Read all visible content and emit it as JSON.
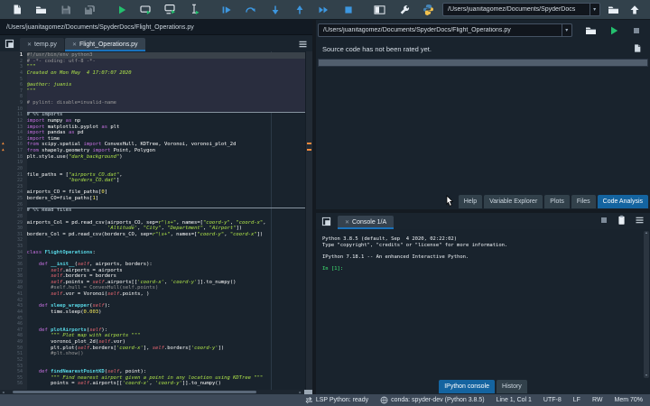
{
  "colors": {
    "accent": "#1464A0",
    "selection": "#1A72BB",
    "run_green": "#24c06e",
    "debug_blue": "#3d97e0",
    "warning": "#f08a3c",
    "background": "#19232D",
    "toolbar": "#32414B",
    "statusbar": "#3d4958",
    "keyword": "#c670e0",
    "string": "#b0e549",
    "comment": "#999999",
    "number": "#faed5c",
    "instance": "#ee6772",
    "definition": "#57d6e4"
  },
  "toolbar": {
    "cwd": "/Users/juanitagomez/Documents/SpyderDocs",
    "items": [
      {
        "name": "new-file",
        "icon": "doc"
      },
      {
        "name": "open-file",
        "icon": "folder"
      },
      {
        "name": "save-file",
        "icon": "save",
        "disabled": true
      },
      {
        "name": "save-all",
        "icon": "save-all",
        "disabled": true
      },
      {
        "sep": true
      },
      {
        "name": "run-file",
        "icon": "play-green"
      },
      {
        "name": "run-cell",
        "icon": "run-cell"
      },
      {
        "name": "run-cell-advance",
        "icon": "run-cell-advance"
      },
      {
        "name": "run-selection",
        "icon": "run-selection"
      },
      {
        "sep": true
      },
      {
        "name": "debug-file",
        "icon": "debug-play"
      },
      {
        "name": "debug-step-over",
        "icon": "debug-step"
      },
      {
        "name": "debug-step-into",
        "icon": "step-into"
      },
      {
        "name": "debug-step-out",
        "icon": "step-out"
      },
      {
        "name": "debug-continue",
        "icon": "continue"
      },
      {
        "name": "debug-stop",
        "icon": "stop-blue"
      },
      {
        "sep": true
      },
      {
        "name": "maximize-pane",
        "icon": "panes"
      },
      {
        "name": "preferences",
        "icon": "wrench"
      },
      {
        "name": "python-path-manager",
        "icon": "python"
      }
    ]
  },
  "editor": {
    "path": "/Users/juanitagomez/Documents/SpyderDocs/Flight_Operations.py",
    "tabs": [
      {
        "label": "temp.py",
        "active": false
      },
      {
        "label": "Flight_Operations.py",
        "active": true
      }
    ],
    "current_line": 1,
    "current_cell_end": 10,
    "lines": [
      {
        "n": 1,
        "t": [
          [
            "c",
            "#!/usr/bin/env python3"
          ]
        ]
      },
      {
        "n": 2,
        "t": [
          [
            "c",
            "# -*- coding: utf-8 -*-"
          ]
        ]
      },
      {
        "n": 3,
        "t": [
          [
            "s",
            "\"\"\""
          ]
        ]
      },
      {
        "n": 4,
        "t": [
          [
            "s",
            "Created on Mon May  4 17:07:07 2020"
          ]
        ]
      },
      {
        "n": 5,
        "t": []
      },
      {
        "n": 6,
        "t": [
          [
            "s",
            "@author: juanis"
          ]
        ]
      },
      {
        "n": 7,
        "t": [
          [
            "s",
            "\"\"\""
          ]
        ]
      },
      {
        "n": 8,
        "t": []
      },
      {
        "n": 9,
        "t": [
          [
            "c",
            "# pylint: disable=invalid-name"
          ]
        ]
      },
      {
        "n": 10,
        "t": []
      },
      {
        "n": 11,
        "sep": true,
        "t": [
          [
            "x",
            "# %% Imports"
          ]
        ]
      },
      {
        "n": 12,
        "t": [
          [
            "k",
            "import"
          ],
          [
            "n",
            " numpy "
          ],
          [
            "k",
            "as"
          ],
          [
            "n",
            " np"
          ]
        ]
      },
      {
        "n": 13,
        "t": [
          [
            "k",
            "import"
          ],
          [
            "n",
            " matplotlib.pyplot "
          ],
          [
            "k",
            "as"
          ],
          [
            "n",
            " plt"
          ]
        ]
      },
      {
        "n": 14,
        "t": [
          [
            "k",
            "import"
          ],
          [
            "n",
            " pandas "
          ],
          [
            "k",
            "as"
          ],
          [
            "n",
            " pd"
          ]
        ]
      },
      {
        "n": 15,
        "t": [
          [
            "k",
            "import"
          ],
          [
            "n",
            " time"
          ]
        ]
      },
      {
        "n": 16,
        "w": true,
        "t": [
          [
            "k",
            "from"
          ],
          [
            "n",
            " scipy.spatial "
          ],
          [
            "k",
            "import"
          ],
          [
            "n",
            " ConvexHull, KDTree, Voronoi, voronoi_plot_2d"
          ]
        ]
      },
      {
        "n": 17,
        "w": true,
        "t": [
          [
            "k",
            "from"
          ],
          [
            "n",
            " shapely.geometry "
          ],
          [
            "k",
            "import"
          ],
          [
            "n",
            " Point, Polygon"
          ]
        ]
      },
      {
        "n": 18,
        "t": [
          [
            "n",
            "plt.style.use("
          ],
          [
            "s",
            "\"dark_background\""
          ],
          [
            "n",
            ")"
          ]
        ]
      },
      {
        "n": 19,
        "t": []
      },
      {
        "n": 20,
        "t": []
      },
      {
        "n": 21,
        "t": [
          [
            "n",
            "file_paths = ["
          ],
          [
            "s",
            "\"airports_CO.dat\""
          ],
          [
            "n",
            ","
          ]
        ]
      },
      {
        "n": 22,
        "t": [
          [
            "n",
            "              "
          ],
          [
            "s",
            "\"borders_CO.dat\""
          ],
          [
            "n",
            "]"
          ]
        ]
      },
      {
        "n": 23,
        "t": []
      },
      {
        "n": 24,
        "t": [
          [
            "n",
            "airports_CO = file_paths["
          ],
          [
            "u",
            "0"
          ],
          [
            "n",
            "]"
          ]
        ]
      },
      {
        "n": 25,
        "t": [
          [
            "n",
            "borders_CO=file_paths["
          ],
          [
            "u",
            "1"
          ],
          [
            "n",
            "]"
          ]
        ]
      },
      {
        "n": 26,
        "t": []
      },
      {
        "n": 27,
        "sep": true,
        "t": [
          [
            "x",
            "# %% Read files"
          ]
        ]
      },
      {
        "n": 28,
        "t": []
      },
      {
        "n": 29,
        "t": [
          [
            "n",
            "airports_Col = pd.read_csv(airports_CO, sep="
          ],
          [
            "s",
            "r\"\\s+\""
          ],
          [
            "n",
            ", names=["
          ],
          [
            "s",
            "\"coord-y\""
          ],
          [
            "n",
            ", "
          ],
          [
            "s",
            "\"coord-x\""
          ],
          [
            "n",
            ","
          ]
        ]
      },
      {
        "n": 30,
        "t": [
          [
            "n",
            "                           "
          ],
          [
            "s",
            "'Altitude'"
          ],
          [
            "n",
            ", "
          ],
          [
            "s",
            "\"City\""
          ],
          [
            "n",
            ", "
          ],
          [
            "s",
            "\"Department\""
          ],
          [
            "n",
            ", "
          ],
          [
            "s",
            "\"Airport\""
          ],
          [
            "n",
            "])"
          ]
        ]
      },
      {
        "n": 31,
        "t": [
          [
            "n",
            "borders_Col = pd.read_csv(borders_CO, sep="
          ],
          [
            "s",
            "r\"\\s+\""
          ],
          [
            "n",
            ", names=["
          ],
          [
            "s",
            "\"coord-y\""
          ],
          [
            "n",
            ", "
          ],
          [
            "s",
            "\"coord-x\""
          ],
          [
            "n",
            "])"
          ]
        ]
      },
      {
        "n": 32,
        "t": []
      },
      {
        "n": 33,
        "t": []
      },
      {
        "n": 34,
        "t": [
          [
            "k",
            "class"
          ],
          [
            "n",
            " "
          ],
          [
            "d",
            "FlightOperations"
          ],
          [
            "n",
            ":"
          ]
        ]
      },
      {
        "n": 35,
        "t": []
      },
      {
        "n": 36,
        "t": [
          [
            "n",
            "    "
          ],
          [
            "k",
            "def"
          ],
          [
            "n",
            " "
          ],
          [
            "d",
            "__init__"
          ],
          [
            "n",
            "("
          ],
          [
            "i",
            "self"
          ],
          [
            "n",
            ", airports, borders):"
          ]
        ]
      },
      {
        "n": 37,
        "t": [
          [
            "n",
            "        "
          ],
          [
            "i",
            "self"
          ],
          [
            "n",
            ".airports = airports"
          ]
        ]
      },
      {
        "n": 38,
        "t": [
          [
            "n",
            "        "
          ],
          [
            "i",
            "self"
          ],
          [
            "n",
            ".borders = borders"
          ]
        ]
      },
      {
        "n": 39,
        "t": [
          [
            "n",
            "        "
          ],
          [
            "i",
            "self"
          ],
          [
            "n",
            ".points = "
          ],
          [
            "i",
            "self"
          ],
          [
            "n",
            ".airports[["
          ],
          [
            "s",
            "'coord-x'"
          ],
          [
            "n",
            ", "
          ],
          [
            "s",
            "'coord-y'"
          ],
          [
            "n",
            "]].to_numpy()"
          ]
        ]
      },
      {
        "n": 40,
        "t": [
          [
            "c",
            "        #self.hull = ConvexHull(self.points)"
          ]
        ]
      },
      {
        "n": 41,
        "t": [
          [
            "n",
            "        "
          ],
          [
            "i",
            "self"
          ],
          [
            "n",
            ".vor = Voronoi("
          ],
          [
            "i",
            "self"
          ],
          [
            "n",
            ".points, )"
          ]
        ]
      },
      {
        "n": 42,
        "t": []
      },
      {
        "n": 43,
        "t": [
          [
            "n",
            "    "
          ],
          [
            "k",
            "def"
          ],
          [
            "n",
            " "
          ],
          [
            "d",
            "sleep_wrapper"
          ],
          [
            "n",
            "("
          ],
          [
            "i",
            "self"
          ],
          [
            "n",
            "):"
          ]
        ]
      },
      {
        "n": 44,
        "t": [
          [
            "n",
            "        time.sleep("
          ],
          [
            "u",
            "0.003"
          ],
          [
            "n",
            ")"
          ]
        ]
      },
      {
        "n": 45,
        "t": []
      },
      {
        "n": 46,
        "t": []
      },
      {
        "n": 47,
        "t": [
          [
            "n",
            "    "
          ],
          [
            "k",
            "def"
          ],
          [
            "n",
            " "
          ],
          [
            "d",
            "plotAirports"
          ],
          [
            "n",
            "("
          ],
          [
            "i",
            "self"
          ],
          [
            "n",
            "):"
          ]
        ]
      },
      {
        "n": 48,
        "t": [
          [
            "n",
            "        "
          ],
          [
            "s",
            "\"\"\" Plot map with airports \"\"\""
          ]
        ]
      },
      {
        "n": 49,
        "t": [
          [
            "n",
            "        voronoi_plot_2d("
          ],
          [
            "i",
            "self"
          ],
          [
            "n",
            ".vor)"
          ]
        ]
      },
      {
        "n": 50,
        "t": [
          [
            "n",
            "        plt.plot("
          ],
          [
            "i",
            "self"
          ],
          [
            "n",
            ".borders["
          ],
          [
            "s",
            "'coord-x'"
          ],
          [
            "n",
            "], "
          ],
          [
            "i",
            "self"
          ],
          [
            "n",
            ".borders["
          ],
          [
            "s",
            "'coord-y'"
          ],
          [
            "n",
            "])"
          ]
        ]
      },
      {
        "n": 51,
        "t": [
          [
            "c",
            "        #plt.show()"
          ]
        ]
      },
      {
        "n": 52,
        "t": []
      },
      {
        "n": 53,
        "t": []
      },
      {
        "n": 54,
        "t": [
          [
            "n",
            "    "
          ],
          [
            "k",
            "def"
          ],
          [
            "n",
            " "
          ],
          [
            "d",
            "findNearestPointKD"
          ],
          [
            "n",
            "("
          ],
          [
            "i",
            "self"
          ],
          [
            "n",
            ", point):"
          ]
        ]
      },
      {
        "n": 55,
        "t": [
          [
            "n",
            "        "
          ],
          [
            "s",
            "\"\"\" Find nearest airport given a point in any location using KDTree \"\"\""
          ]
        ]
      },
      {
        "n": 56,
        "t": [
          [
            "n",
            "        points = "
          ],
          [
            "i",
            "self"
          ],
          [
            "n",
            ".airports[["
          ],
          [
            "s",
            "'coord-x'"
          ],
          [
            "n",
            ", "
          ],
          [
            "s",
            "'coord-y'"
          ],
          [
            "n",
            "]].to_numpy()"
          ]
        ]
      }
    ]
  },
  "analysis_pane": {
    "path": "/Users/juanitagomez/Documents/SpyderDocs/Flight_Operations.py",
    "message": "Source code has not been rated yet.",
    "tabs": [
      "Help",
      "Variable Explorer",
      "Plots",
      "Files",
      "Code Analysis"
    ],
    "active_tab": "Code Analysis"
  },
  "console_pane": {
    "tab": "Console 1/A",
    "lines": [
      {
        "text": "Python 3.8.5 (default, Sep  4 2020, 02:22:02)"
      },
      {
        "text": "Type \"copyright\", \"credits\" or \"license\" for more information."
      },
      {
        "text": ""
      },
      {
        "text": "IPython 7.18.1 -- An enhanced Interactive Python."
      },
      {
        "text": ""
      },
      {
        "text": "In [1]:",
        "prompt": true
      }
    ],
    "tabs": [
      "IPython console",
      "History"
    ],
    "active_tab": "IPython console"
  },
  "statusbar": {
    "items": [
      {
        "icon": "lsp",
        "label": "LSP Python: ready",
        "interactable": true
      },
      {
        "icon": "conda",
        "label": "conda: spyder-dev (Python 3.8.5)",
        "interactable": true
      },
      {
        "label": "Line 1, Col 1"
      },
      {
        "label": "UTF-8"
      },
      {
        "label": "LF"
      },
      {
        "label": "RW"
      },
      {
        "label": "Mem 70%"
      }
    ]
  }
}
